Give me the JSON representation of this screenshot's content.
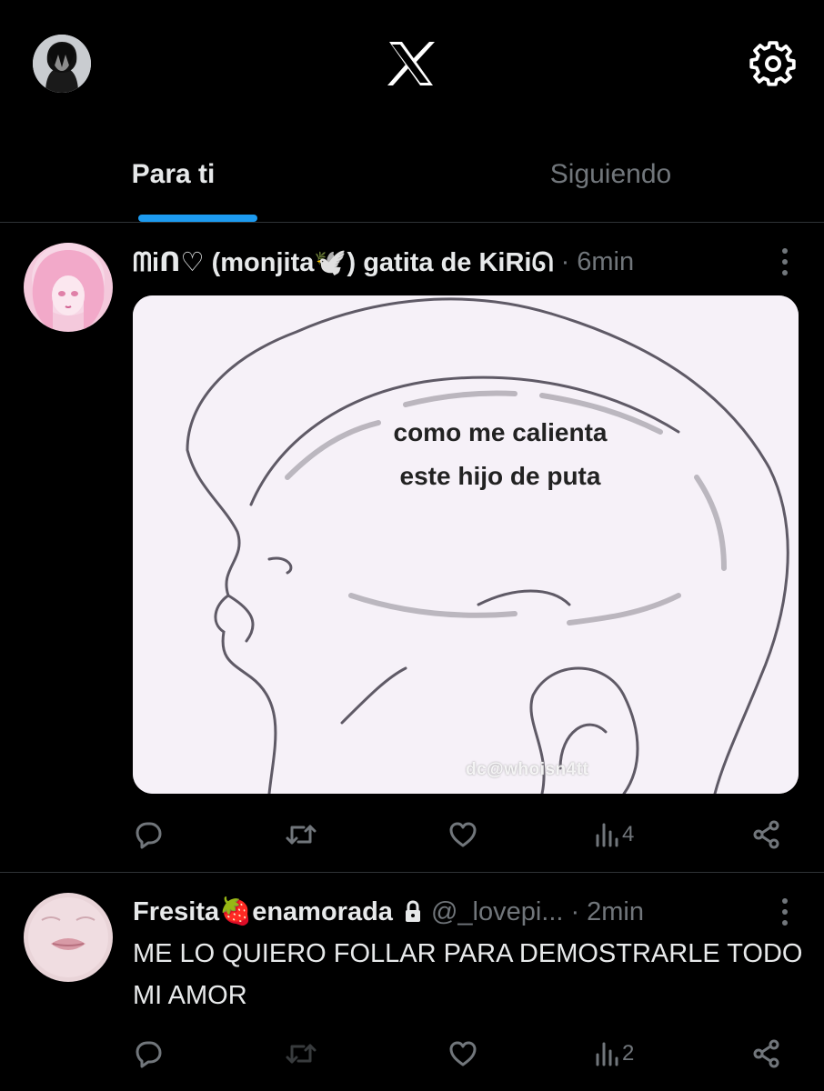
{
  "topbar": {
    "logo": "x-logo-icon",
    "settings_icon": "gear-icon"
  },
  "tabs": [
    {
      "label": "Para ti",
      "active": true
    },
    {
      "label": "Siguiendo",
      "active": false
    }
  ],
  "colors": {
    "background": "#000000",
    "accent": "#1d9bf0",
    "text_primary": "#e7e9ea",
    "text_secondary": "#71767b",
    "divider": "#2f3336"
  },
  "posts": [
    {
      "name": "ᗰiᑎ♡ (monjita🕊️) gatita de KiRiᘏ",
      "time": "6min",
      "separator": "·",
      "media": {
        "caption_line1": "como me calienta",
        "caption_line2": "este hijo de puta",
        "watermark": "dc@whoisn4tt"
      },
      "views": "4"
    },
    {
      "name": "Fresita🍓enamorada",
      "handle": "@_lovepi...",
      "time": "2min",
      "separator": "·",
      "protected": true,
      "text": "ME LO QUIERO FOLLAR PARA DEMOSTRARLE TODO MI AMOR",
      "views": "2"
    }
  ]
}
